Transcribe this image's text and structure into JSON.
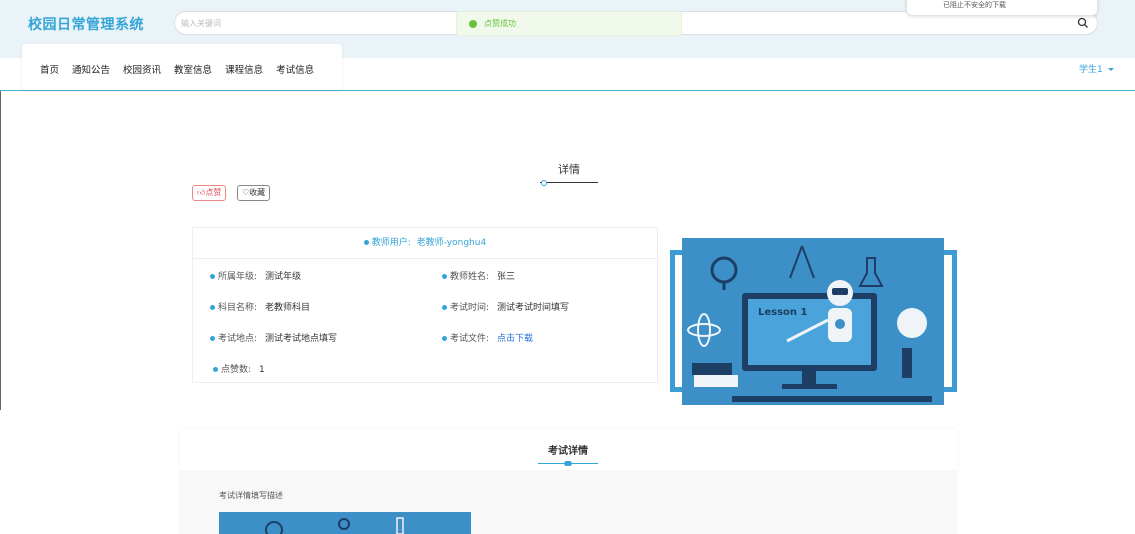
{
  "header": {
    "brand": "校园日常管理系统",
    "search_placeholder": "输入关键词",
    "toast": "点赞成功",
    "download_notice": "已阻止不安全的下载"
  },
  "nav": {
    "items": [
      "首页",
      "通知公告",
      "校园资讯",
      "教室信息",
      "课程信息",
      "考试信息"
    ],
    "user": "学生1"
  },
  "detail": {
    "title": "详情",
    "like_label": "点赞",
    "fav_label": "收藏",
    "teacher_label": "教师用户:",
    "teacher_value": "老教师-yonghu4",
    "fields": {
      "grade_label": "所属年级:",
      "grade_value": "测试年级",
      "teacher_name_label": "教师姓名:",
      "teacher_name_value": "张三",
      "subject_label": "科目名称:",
      "subject_value": "老教师科目",
      "time_label": "考试时间:",
      "time_value": "测试考试时间填写",
      "place_label": "考试地点:",
      "place_value": "测试考试地点填写",
      "file_label": "考试文件:",
      "file_link": "点击下载",
      "likes_label": "点赞数:",
      "likes_value": "1"
    },
    "illustration_text": "Lesson 1"
  },
  "exam_section": {
    "title": "考试详情",
    "description": "考试详情填写描述"
  },
  "colors": {
    "accent": "#35a5d8",
    "success": "#67c23a",
    "illustration_bg": "#3d8fc7"
  }
}
